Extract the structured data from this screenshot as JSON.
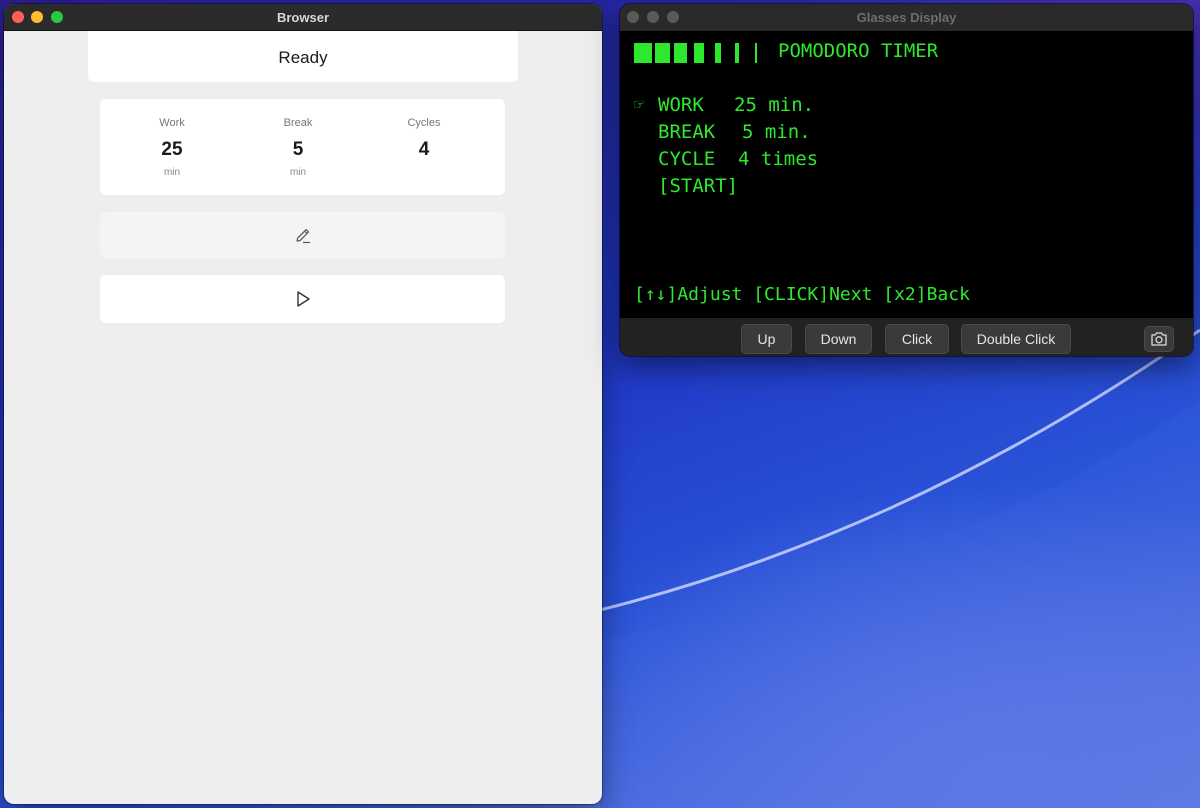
{
  "browser": {
    "title": "Browser",
    "status": "Ready",
    "settings": [
      {
        "label": "Work",
        "value": "25",
        "unit": "min"
      },
      {
        "label": "Break",
        "value": "5",
        "unit": "min"
      },
      {
        "label": "Cycles",
        "value": "4",
        "unit": ""
      }
    ],
    "edit_icon": "pencil-icon",
    "play_icon": "play-icon"
  },
  "glasses": {
    "title": "Glasses Display",
    "header": "POMODORO TIMER",
    "pointer": "☞",
    "menu": [
      {
        "label": "WORK",
        "value": "25 min."
      },
      {
        "label": "BREAK",
        "value": "5 min."
      },
      {
        "label": "CYCLE",
        "value": "4 times"
      }
    ],
    "start_label": "[START]",
    "hint": "[↑↓]Adjust [CLICK]Next [x2]Back",
    "buttons": {
      "up": "Up",
      "down": "Down",
      "click": "Click",
      "double_click": "Double Click"
    },
    "camera_icon": "camera-icon",
    "text_color": "#2ee82e"
  }
}
